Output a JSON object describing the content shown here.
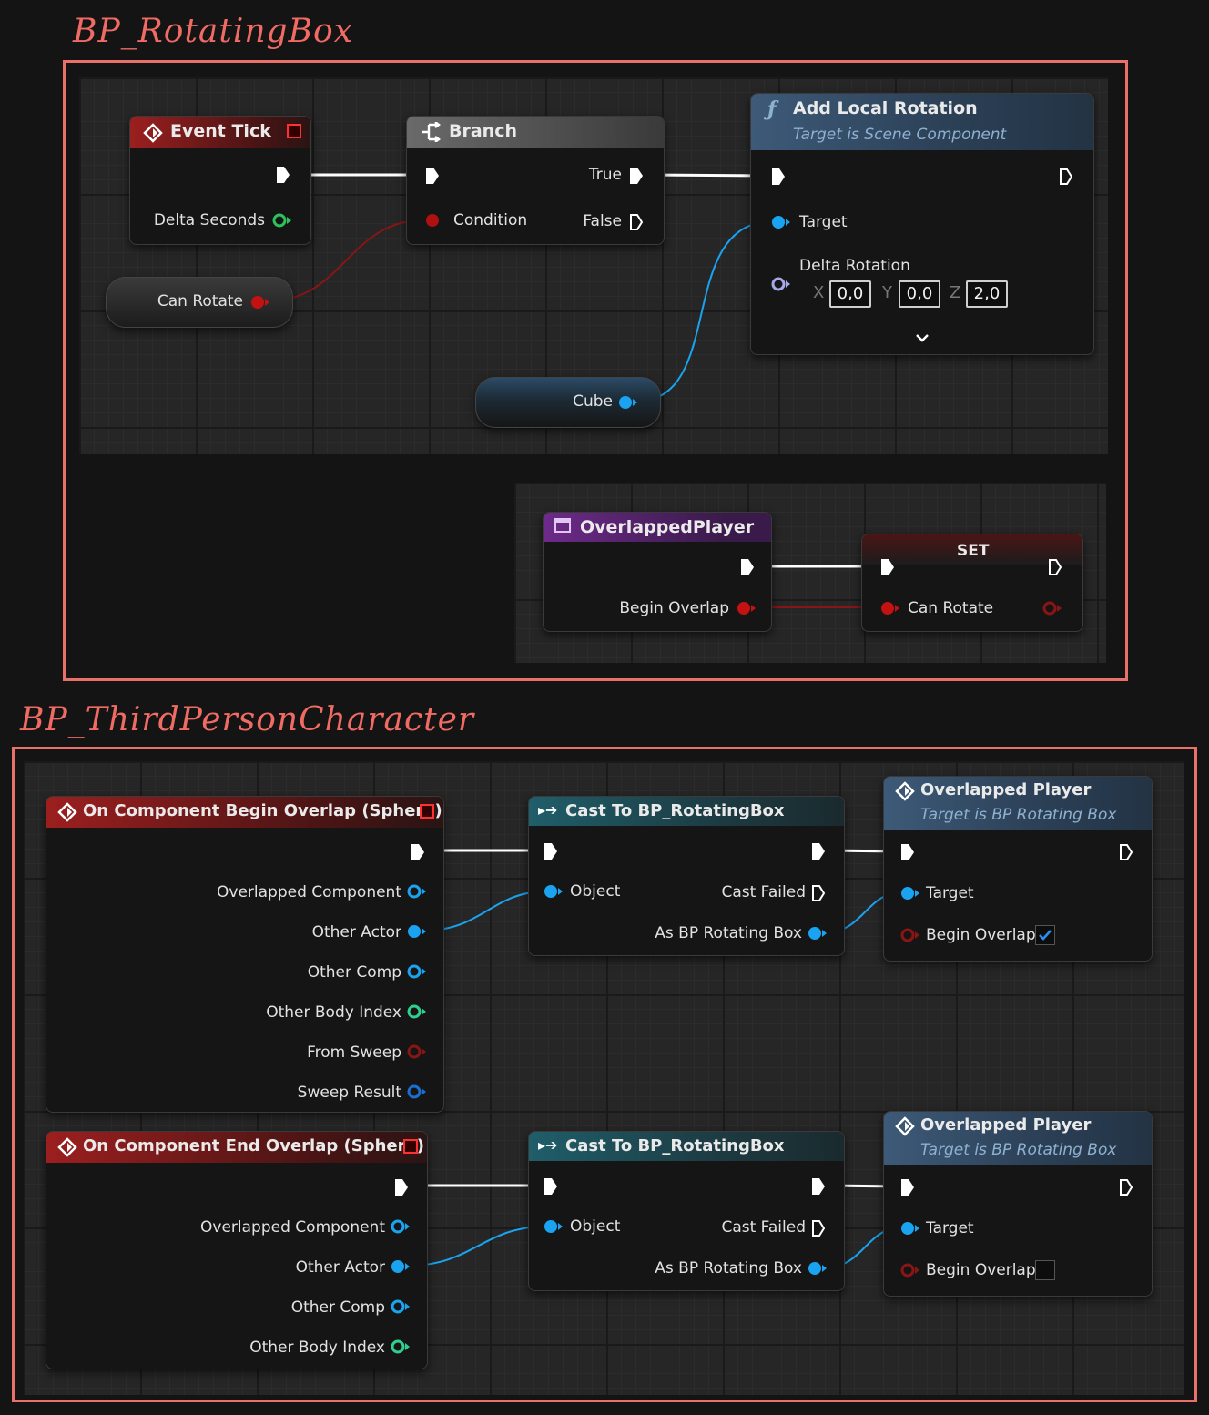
{
  "sections": {
    "rotating_box_title": "BP_RotatingBox",
    "third_person_title": "BP_ThirdPersonCharacter"
  },
  "rotating_box": {
    "event_tick": {
      "title": "Event Tick",
      "pin_delta": "Delta Seconds"
    },
    "branch": {
      "title": "Branch",
      "pin_condition": "Condition",
      "pin_true": "True",
      "pin_false": "False"
    },
    "add_local_rotation": {
      "title": "Add Local Rotation",
      "subtitle": "Target is Scene Component",
      "pin_target": "Target",
      "pin_delta_rotation": "Delta Rotation",
      "x_label": "X",
      "x_value": "0,0",
      "y_label": "Y",
      "y_value": "0,0",
      "z_label": "Z",
      "z_value": "2,0"
    },
    "can_rotate_var": "Can Rotate",
    "cube_var": "Cube",
    "overlapped_player_event": {
      "title": "OverlappedPlayer",
      "pin_begin_overlap": "Begin Overlap"
    },
    "set_node": {
      "title": "SET",
      "pin_can_rotate": "Can Rotate"
    }
  },
  "third_person": {
    "begin_overlap_event": {
      "title": "On Component Begin Overlap (Sphere)",
      "pins": [
        "Overlapped Component",
        "Other Actor",
        "Other Comp",
        "Other Body Index",
        "From Sweep",
        "Sweep Result"
      ]
    },
    "end_overlap_event": {
      "title": "On Component End Overlap (Sphere)",
      "pins": [
        "Overlapped Component",
        "Other Actor",
        "Other Comp",
        "Other Body Index"
      ]
    },
    "cast_1": {
      "title": "Cast To BP_RotatingBox",
      "pin_object": "Object",
      "pin_cast_failed": "Cast Failed",
      "pin_as": "As BP Rotating Box"
    },
    "cast_2": {
      "title": "Cast To BP_RotatingBox",
      "pin_object": "Object",
      "pin_cast_failed": "Cast Failed",
      "pin_as": "As BP Rotating Box"
    },
    "overlapped_player_1": {
      "title": "Overlapped Player",
      "subtitle": "Target is BP Rotating Box",
      "pin_target": "Target",
      "pin_begin_overlap": "Begin Overlap",
      "checked": true
    },
    "overlapped_player_2": {
      "title": "Overlapped Player",
      "subtitle": "Target is BP Rotating Box",
      "pin_target": "Target",
      "pin_begin_overlap": "Begin Overlap",
      "checked": false
    }
  },
  "colors": {
    "frame": "#e8716a",
    "exec": "#ffffff",
    "bool": "#c41212",
    "object": "#1aa3f0",
    "float": "#2ec05a",
    "int": "#2fd08f",
    "struct": "#1a6fd0"
  }
}
